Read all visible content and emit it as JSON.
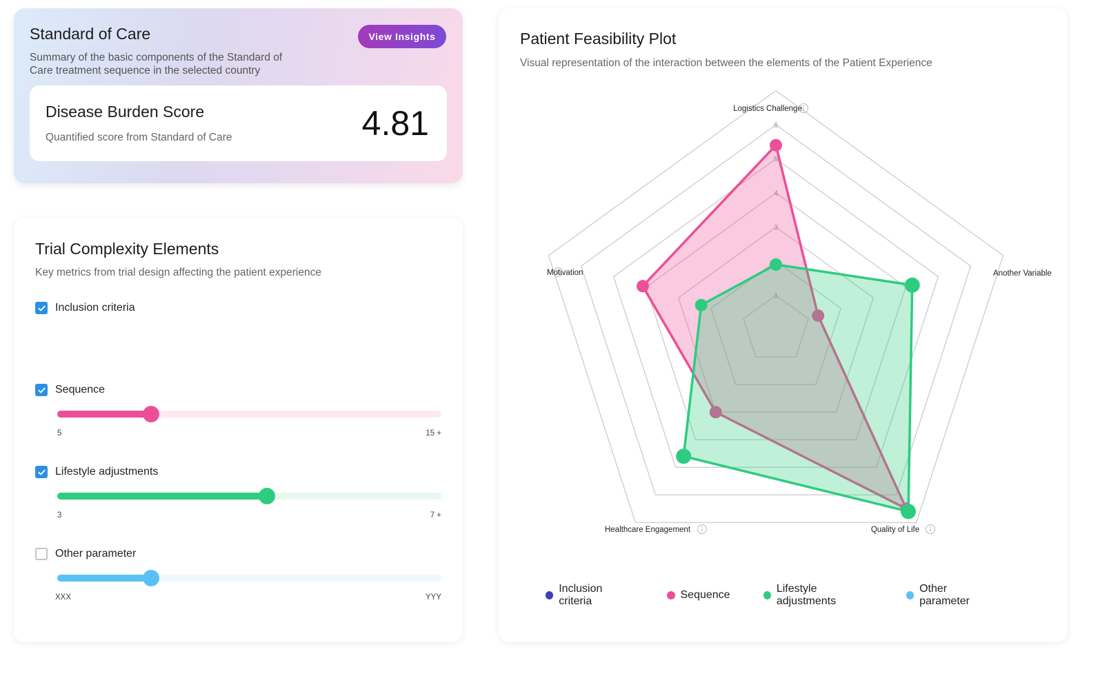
{
  "standard_of_care": {
    "title": "Standard of Care",
    "description": "Summary of the basic components of the Standard of Care treatment sequence in the selected country",
    "button_label": "View Insights",
    "score": {
      "title": "Disease Burden Score",
      "subtitle": "Quantified score from Standard of Care",
      "value": "4.81"
    }
  },
  "trial_complexity": {
    "title": "Trial Complexity Elements",
    "description": "Key metrics from trial design affecting the patient experience",
    "elements": [
      {
        "label": "Inclusion criteria",
        "checked": true
      },
      {
        "label": "Sequence",
        "checked": true,
        "min_label": "5",
        "max_label": "15 +",
        "fraction": 0.245,
        "color": "#ec4f97",
        "track_color": "#fde8f1"
      },
      {
        "label": "Lifestyle adjustments",
        "checked": true,
        "min_label": "3",
        "max_label": "7 +",
        "fraction": 0.546,
        "color": "#2ecc7f",
        "track_color": "#e8f8ef"
      },
      {
        "label": "Other parameter",
        "checked": false,
        "min_label": "XXX",
        "max_label": "YYY",
        "fraction": 0.245,
        "color": "#5bc0f5",
        "track_color": "#eef7fd"
      }
    ]
  },
  "feasibility": {
    "title": "Patient Feasibility Plot",
    "description": "Visual representation of the interaction between the elements of the Patient Experience",
    "legend": [
      {
        "label": "Inclusion criteria",
        "color": "#3f3fb8"
      },
      {
        "label": "Sequence",
        "color": "#ec4f97"
      },
      {
        "label": "Lifestyle adjustments",
        "color": "#2ecc7f"
      },
      {
        "label": "Other parameter",
        "color": "#5bc0f5"
      }
    ]
  },
  "chart_data": {
    "type": "radar",
    "title": "Patient Feasibility Plot",
    "axes": [
      "Logistics Challenge",
      "Another Variable",
      "Quality of Life",
      "Healthcare Engagement",
      "Motivation"
    ],
    "axis_info_icons": [
      true,
      false,
      true,
      true,
      true
    ],
    "ticks": [
      "1",
      "2",
      "3",
      "4",
      "5",
      "6"
    ],
    "rlim": [
      0,
      7
    ],
    "grid": true,
    "legend_position": "bottom",
    "series": [
      {
        "name": "Sequence",
        "color": "#ec4f97",
        "values": [
          5.4,
          1.3,
          6.5,
          3.0,
          4.1
        ]
      },
      {
        "name": "Lifestyle adjustments",
        "color": "#2ecc7f",
        "values": [
          1.9,
          4.2,
          6.6,
          4.6,
          2.3
        ]
      }
    ]
  }
}
